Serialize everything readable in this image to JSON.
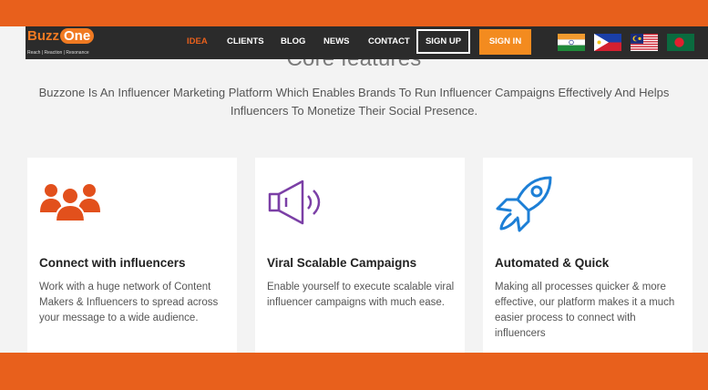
{
  "brand": {
    "logo_main": "Buzz",
    "logo_accent": "One",
    "tagline": "Reach | Reaction | Resonance"
  },
  "nav": {
    "links": [
      {
        "label": "IDEA",
        "active": true
      },
      {
        "label": "CLIENTS",
        "active": false
      },
      {
        "label": "BLOG",
        "active": false
      },
      {
        "label": "NEWS",
        "active": false
      },
      {
        "label": "CONTACT",
        "active": false
      }
    ],
    "signup_label": "SIGN UP",
    "signin_label": "SIGN IN",
    "flags": [
      "india-flag-icon",
      "philippines-flag-icon",
      "malaysia-flag-icon",
      "bangladesh-flag-icon"
    ]
  },
  "main": {
    "section_title": "Core features",
    "intro": "Buzzone Is An Influencer Marketing Platform Which Enables Brands To Run Influencer Campaigns Effectively And Helps Influencers To Monetize Their Social Presence."
  },
  "features": [
    {
      "icon": "people-group-icon",
      "title": "Connect with influencers",
      "description": "Work with a huge network of Content Makers & Influencers to spread across your message to a wide audience."
    },
    {
      "icon": "megaphone-icon",
      "title": "Viral Scalable Campaigns",
      "description": "Enable yourself to execute scalable viral influencer campaigns with much ease."
    },
    {
      "icon": "rocket-icon",
      "title": "Automated & Quick",
      "description": "Making all processes quicker & more effective, our platform makes it a much easier process to connect with influencers"
    }
  ],
  "colors": {
    "accent_orange": "#e8601c",
    "signin_orange": "#f38b1f",
    "nav_dark": "#2b2b2b",
    "people_icon": "#e2501c",
    "megaphone_icon": "#7b3fa6",
    "rocket_icon": "#1d7fd6"
  }
}
